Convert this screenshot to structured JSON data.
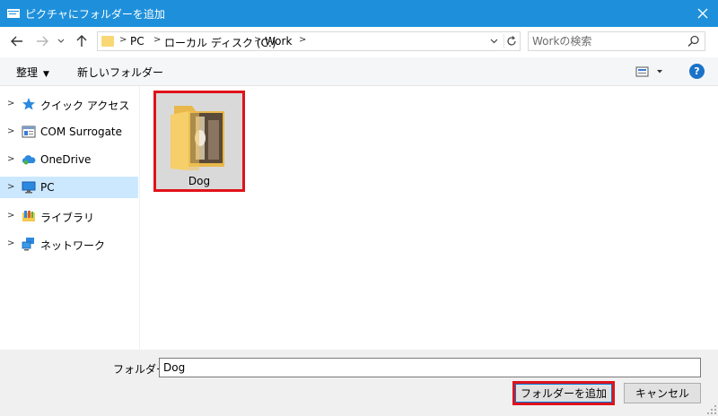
{
  "window": {
    "title": "ピクチャにフォルダーを追加"
  },
  "address": {
    "crumbs": [
      "PC",
      "ローカル ディスク (C:)",
      "Work"
    ]
  },
  "search": {
    "placeholder": "Workの検索"
  },
  "toolbar": {
    "organize": "整理",
    "new_folder": "新しいフォルダー"
  },
  "nav": {
    "items": [
      {
        "label": "クイック アクセス",
        "icon": "star-icon"
      },
      {
        "label": "COM Surrogate",
        "icon": "window-icon"
      },
      {
        "label": "OneDrive",
        "icon": "cloud-icon"
      },
      {
        "label": "PC",
        "icon": "monitor-icon",
        "selected": true
      },
      {
        "label": "ライブラリ",
        "icon": "library-icon"
      },
      {
        "label": "ネットワーク",
        "icon": "network-icon"
      }
    ]
  },
  "content": {
    "items": [
      {
        "name": "Dog",
        "type": "folder"
      }
    ]
  },
  "footer": {
    "folder_label": "フォルダー:",
    "folder_value": "Dog",
    "ok_label": "フォルダーを追加",
    "cancel_label": "キャンセル"
  },
  "colors": {
    "titlebar": "#1e90db",
    "selection": "#cce8ff",
    "highlight": "#e0121b"
  }
}
